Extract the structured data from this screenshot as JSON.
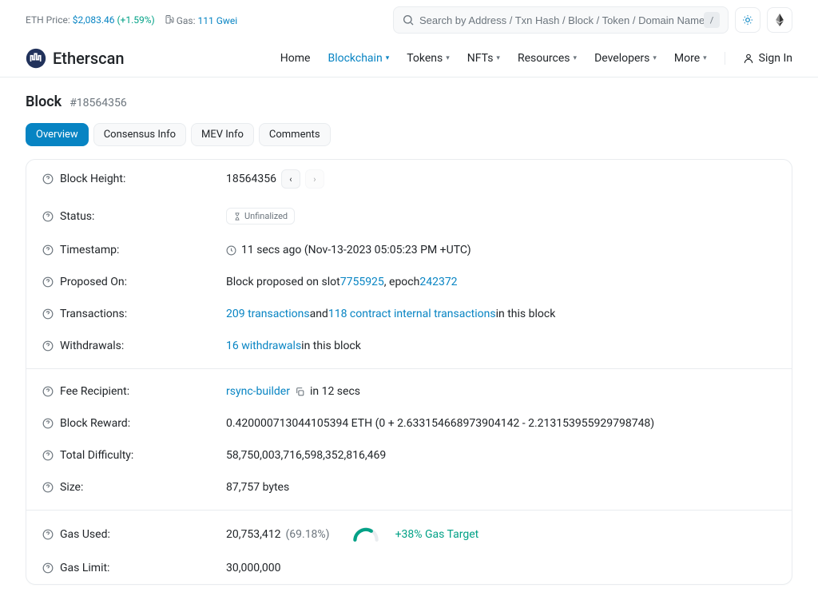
{
  "topbar": {
    "eth_price_label": "ETH Price:",
    "eth_price": "$2,083.46",
    "eth_price_change": "(+1.59%)",
    "gas_label": "Gas:",
    "gas_value": "111 Gwei"
  },
  "search": {
    "placeholder": "Search by Address / Txn Hash / Block / Token / Domain Name"
  },
  "nav": {
    "home": "Home",
    "blockchain": "Blockchain",
    "tokens": "Tokens",
    "nfts": "NFTs",
    "resources": "Resources",
    "developers": "Developers",
    "more": "More",
    "signin": "Sign In"
  },
  "header": {
    "title": "Block",
    "sub": "#18564356"
  },
  "tabs": [
    "Overview",
    "Consensus Info",
    "MEV Info",
    "Comments"
  ],
  "labels": {
    "block_height": "Block Height:",
    "status": "Status:",
    "timestamp": "Timestamp:",
    "proposed_on": "Proposed On:",
    "transactions": "Transactions:",
    "withdrawals": "Withdrawals:",
    "fee_recipient": "Fee Recipient:",
    "block_reward": "Block Reward:",
    "total_difficulty": "Total Difficulty:",
    "size": "Size:",
    "gas_used": "Gas Used:",
    "gas_limit": "Gas Limit:"
  },
  "values": {
    "block_height": "18564356",
    "status_badge": "Unfinalized",
    "timestamp": "11 secs ago (Nov-13-2023 05:05:23 PM +UTC)",
    "proposed_prefix": "Block proposed on slot ",
    "proposed_slot": "7755925",
    "proposed_mid": ", epoch ",
    "proposed_epoch": "242372",
    "tx_count": "209 transactions",
    "tx_mid": " and ",
    "tx_internal": "118 contract internal transactions",
    "tx_suffix": " in this block",
    "withdrawals_count": "16 withdrawals",
    "withdrawals_suffix": " in this block",
    "fee_recipient": "rsync-builder",
    "fee_recipient_suffix": " in 12 secs",
    "block_reward": "0.420000713044105394 ETH (0 + 2.633154668973904142 - 2.213153955929798748)",
    "total_difficulty": "58,750,003,716,598,352,816,469",
    "size": "87,757 bytes",
    "gas_used": "20,753,412",
    "gas_used_pct": "(69.18%)",
    "gas_target": "+38% Gas Target",
    "gas_limit": "30,000,000"
  }
}
